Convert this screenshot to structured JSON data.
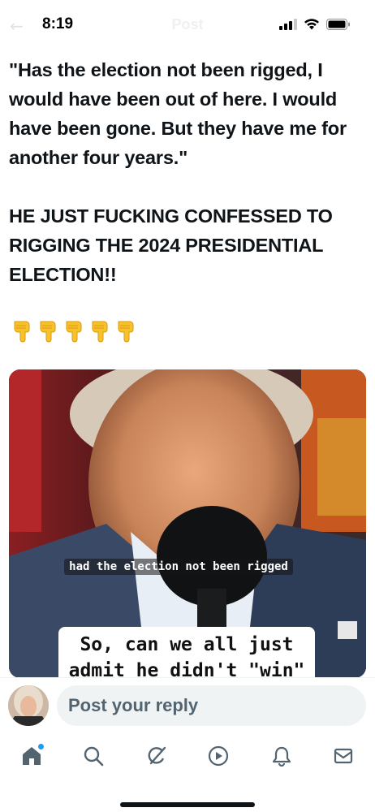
{
  "status_bar": {
    "time": "8:19",
    "faded_title": "Post",
    "back_glyph": "←",
    "icons": [
      "signal-icon",
      "wifi-icon",
      "battery-icon"
    ]
  },
  "post": {
    "text": "\"Has the election not been rigged, I would have been out of here. I would have been gone. But they have me for another four years.\"\n\nHE JUST FUCKING CONFESSED TO RIGGING THE 2024 PRESIDENTIAL ELECTION!!",
    "emojis": [
      "pointing-down-emoji",
      "pointing-down-emoji",
      "pointing-down-emoji",
      "pointing-down-emoji",
      "pointing-down-emoji"
    ]
  },
  "media": {
    "caption_small": "had the election not been rigged",
    "caption_big": "So, can we all just admit he didn't \"win\""
  },
  "reply": {
    "placeholder": "Post your reply"
  },
  "nav": {
    "items": [
      "home-icon",
      "search-icon",
      "grok-icon",
      "video-icon",
      "notifications-icon",
      "messages-icon"
    ],
    "accent": "#1d9bf0"
  },
  "colors": {
    "text": "#0f1419",
    "muted": "#536471",
    "input_bg": "#eff3f4"
  }
}
